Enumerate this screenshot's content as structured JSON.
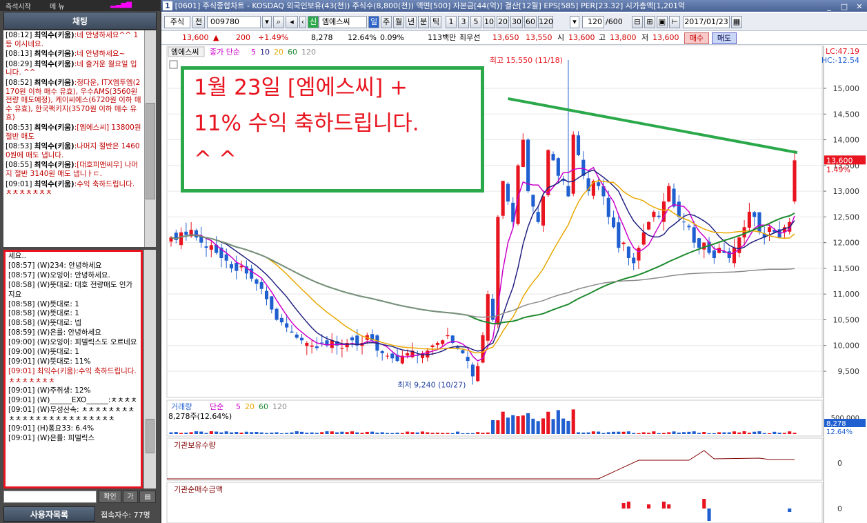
{
  "left_panel": {
    "top_tabs": [
      "즉석시작",
      "메 뉴"
    ],
    "chat_title": "채팅",
    "chat_messages": [
      {
        "time": "[08:12]",
        "user": "최익수(키움)",
        "text": ":네 안녕하세요^^ 1등 이시네요."
      },
      {
        "time": "[08:13]",
        "user": "최익수(키움)",
        "text": ":네 안녕하세요~"
      },
      {
        "time": "[08:29]",
        "user": "최익수(키움)",
        "text": ":네 즐거운 월요일 입니다. ^^"
      },
      {
        "time": "[08:52]",
        "user": "최익수(키움)",
        "text": ":정다운, ITX엠투엠(2170원 이하 매수 유효), 우수AMS(3560원 전량 매도예정), 케이씨에스(6720원 이하 매수 유효), 한국팩키지(3570원 이하 매수 유효)"
      },
      {
        "time": "[08:53]",
        "user": "최익수(키움)",
        "text": ":[엠에스씨] 13800원 절반 매도"
      },
      {
        "time": "[08:53]",
        "user": "최익수(키움)",
        "text": ":나머지 절반은 14600원에 매도 냅니다."
      },
      {
        "time": "[08:55]",
        "user": "최익수(키움)",
        "text": ":[대호피앤씨우] 나머지 절반 3140원 매도 냅니ㅏㄷ."
      },
      {
        "time": "[09:01]",
        "user": "최익수(키움)",
        "text": ":수익 축하드립니다. ㅊㅊㅊㅊㅊㅊㅊ"
      }
    ],
    "chat2_messages": [
      {
        "text": "세요..",
        "style": "plain"
      },
      {
        "text": "[08:57] (W)234: 안녕하세요",
        "style": "plain"
      },
      {
        "text": "[08:57] (W)오잉이: 안녕하세요.",
        "style": "plain"
      },
      {
        "text": "[08:58] (W)뜻대로: 대호 전량매도 인가지요",
        "style": "plain"
      },
      {
        "text": "[08:58] (W)뜻대로: 1",
        "style": "plain"
      },
      {
        "text": "[08:58] (W)뜻대로: 1",
        "style": "plain"
      },
      {
        "text": "[08:58] (W)뜻대로: 넵",
        "style": "plain"
      },
      {
        "text": "[08:59] (W)은률: 안녕하세요",
        "style": "plain"
      },
      {
        "text": "[09:00] (W)오잉이: 피델릭스도 오르네요",
        "style": "plain"
      },
      {
        "text": "[09:00] (W)뜻대로: 1",
        "style": "plain"
      },
      {
        "text": "[09:01] (W)뜻대로: 11%",
        "style": "plain"
      },
      {
        "text": "[09:01] 최익수(키움):수익 축하드립니다. ㅊㅊㅊㅊㅊㅊㅊ",
        "style": "red"
      },
      {
        "text": "[09:01] (W)주취생: 12%",
        "style": "plain"
      },
      {
        "text": "[09:01] (W)______EXO______:ㅊㅊㅊㅊ",
        "style": "plain"
      },
      {
        "text": "[09:01] (W)무성산속: ㅊㅊㅊㅊㅊㅊㅊㅊㅊㅊㅊㅊㅊㅊㅊㅊㅊㅊㅊㅊㅊㅊㅊㅊ",
        "style": "plain"
      },
      {
        "text": "[09:01] (H)퐁요33: 6.4%",
        "style": "plain"
      },
      {
        "text": "[09:01] (W)은률: 피델릭스",
        "style": "plain"
      }
    ],
    "confirm_button": "확인",
    "btn2": "가",
    "users_button": "사용자목록",
    "connected_label": "접속자수: 77명"
  },
  "window": {
    "number": "1",
    "title": "[0601] 주식종합차트 - KOSDAQ 외국인보유(43(천)) 주식수(8,800(천)) 액면[500] 자본금[44(억)] 결산[12월] EPS[585] PER[23.32] 시가총액[1,201억"
  },
  "toolbar": {
    "market_type": "주식",
    "full_label": "전",
    "stock_code": "009780",
    "stock_badge": "신",
    "stock_name": "엠에스씨",
    "periods": [
      "일",
      "주",
      "월",
      "년",
      "분",
      "틱"
    ],
    "active_period": "일",
    "minutes": [
      "1",
      "3",
      "5",
      "10",
      "20",
      "30",
      "60",
      "120"
    ],
    "count": "120",
    "count_total": "/600",
    "date": "2017/01/23"
  },
  "quote": {
    "price": "13,600",
    "change": "200",
    "change_pct": "+1.49%",
    "volume": "8,278",
    "volume_pct": "12.64%",
    "turnover": "0.09%",
    "amount": "113백만",
    "best_label": "최우선",
    "ask": "13,650",
    "bid": "13,550",
    "open_label": "시",
    "open": "13,600",
    "high_label": "고",
    "high": "13,800",
    "low_label": "저",
    "low": "13,600",
    "buy_label": "매수",
    "sell_label": "매도"
  },
  "annotation": {
    "line1": "1월 23일 [엠에스씨] +",
    "line2": "11% 수익 축하드립니다.",
    "line3": "^ ^"
  },
  "legend": {
    "name": "엠에스씨",
    "price_type": "종가 단순",
    "ma": [
      "5",
      "10",
      "20",
      "60",
      "120"
    ],
    "vol_label": "거래량",
    "vol_type": "단순",
    "vol_ma": [
      "5",
      "20",
      "60",
      "120"
    ],
    "vol_value": "8,278주(12.64%)",
    "inst_hold_label": "기관보유수량",
    "inst_net_label": "기관순매수금액"
  },
  "colors": {
    "up": "#e8141f",
    "down": "#1f5fd0",
    "ma5": "#cc00cc",
    "ma10": "#202080",
    "ma20": "#e8a800",
    "ma60": "#1e8a2e",
    "ma120": "#8a8a8a",
    "trend": "#2aa84a"
  },
  "chart_data": [
    {
      "type": "candlestick",
      "title": "엠에스씨",
      "y_ticks": [
        "15,000",
        "14,500",
        "14,000",
        "13,500",
        "13,000",
        "12,500",
        "12,000",
        "11,500",
        "11,000",
        "10,500",
        "10,000",
        "9,500"
      ],
      "ylim": [
        9000,
        15800
      ],
      "lc_label": "LC:47.19",
      "hc_label": "HC:-12.54",
      "last_price_label": "13,600",
      "last_pct_label": "1.49%",
      "max_annotation": "최고 15,550 (11/18)",
      "min_annotation": "최저 9,240 (10/27)",
      "trendline": {
        "start_value": 14800,
        "end_value": 13750
      },
      "closes": [
        12100,
        12050,
        12200,
        12150,
        12250,
        12100,
        12000,
        11900,
        11950,
        11800,
        11700,
        11650,
        11500,
        11450,
        11550,
        11400,
        11300,
        11200,
        11100,
        10900,
        10700,
        10500,
        10450,
        10350,
        10250,
        10150,
        10100,
        10050,
        10000,
        9950,
        10050,
        10000,
        10100,
        10000,
        9950,
        10050,
        10100,
        10000,
        10050,
        10200,
        10100,
        9900,
        9850,
        9800,
        9750,
        9700,
        9800,
        9850,
        9900,
        9800,
        9850,
        9900,
        10000,
        10050,
        10100,
        10200,
        10050,
        9950,
        9850,
        9700,
        9400,
        9600,
        10200,
        11000,
        10500,
        12500,
        13200,
        12800,
        12400,
        13500,
        14000,
        13000,
        12700,
        12400,
        12900,
        13800,
        13600,
        13300,
        13200,
        12900,
        14100,
        13700,
        13300,
        13000,
        13200,
        13100,
        12900,
        12500,
        12300,
        11900,
        12000,
        11700,
        11600,
        11900,
        12200,
        12400,
        12600,
        12500,
        12800,
        13100,
        12700,
        12500,
        12400,
        12300,
        12000,
        11900,
        12000,
        11800,
        11700,
        11900,
        11800,
        11700,
        11900,
        12100,
        12300,
        12600,
        12500,
        12200,
        12100,
        12300,
        12200,
        12100,
        12300,
        12400,
        13600
      ],
      "last_open": 12800,
      "last_high": 13800,
      "last_low": 12750
    },
    {
      "type": "bar",
      "title": "거래량",
      "y_tick_label": "500,000",
      "last_value_label": "8,278",
      "last_pct_label": "12.64%"
    },
    {
      "type": "line",
      "title": "기관보유수량",
      "y_tick_label": "0"
    },
    {
      "type": "bar",
      "title": "기관순매수금액",
      "y_tick_label": "0"
    }
  ]
}
